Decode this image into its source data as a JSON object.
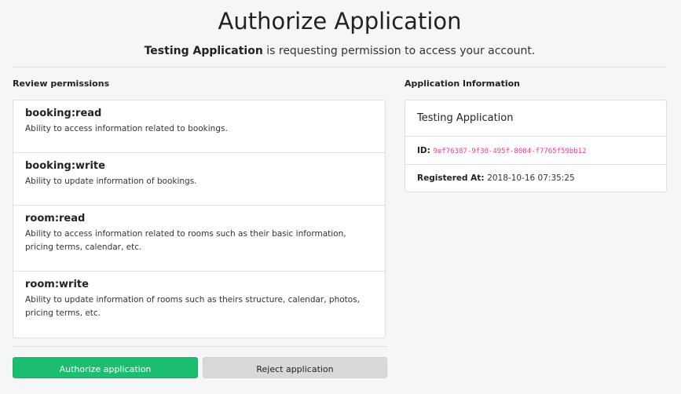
{
  "header": {
    "title": "Authorize Application",
    "app_name": "Testing Application",
    "request_text": " is requesting permission to access your account."
  },
  "permissions": {
    "heading": "Review permissions",
    "items": [
      {
        "name": "booking:read",
        "description": "Ability to access information related to bookings."
      },
      {
        "name": "booking:write",
        "description": "Ability to update information of bookings."
      },
      {
        "name": "room:read",
        "description": "Ability to access information related to rooms such as their basic information, pricing terms, calendar, etc."
      },
      {
        "name": "room:write",
        "description": "Ability to update information of rooms such as theirs structure, calendar, photos, pricing terms, etc."
      }
    ]
  },
  "app_info": {
    "heading": "Application Information",
    "name": "Testing Application",
    "id_label": "ID:",
    "id_value": "9ef76387-9f30-495f-8084-f7765f59bb12",
    "registered_label": "Registered At:",
    "registered_value": "2018-10-16 07:35:25"
  },
  "actions": {
    "authorize_label": "Authorize application",
    "reject_label": "Reject application",
    "authorize_color": "#1bbd6e",
    "reject_color": "#d9d9d9"
  }
}
